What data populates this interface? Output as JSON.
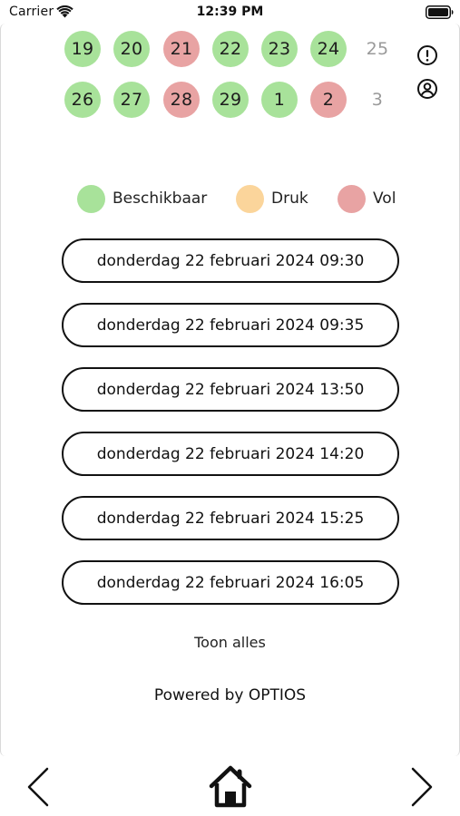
{
  "status_bar": {
    "carrier": "Carrier",
    "time": "12:39 PM"
  },
  "calendar": {
    "weeks": [
      [
        {
          "day": "19",
          "status": "available"
        },
        {
          "day": "20",
          "status": "available"
        },
        {
          "day": "21",
          "status": "full"
        },
        {
          "day": "22",
          "status": "available"
        },
        {
          "day": "23",
          "status": "available"
        },
        {
          "day": "24",
          "status": "available"
        },
        {
          "day": "25",
          "status": "unavailable"
        }
      ],
      [
        {
          "day": "26",
          "status": "available"
        },
        {
          "day": "27",
          "status": "available"
        },
        {
          "day": "28",
          "status": "full"
        },
        {
          "day": "29",
          "status": "available"
        },
        {
          "day": "1",
          "status": "available"
        },
        {
          "day": "2",
          "status": "full"
        },
        {
          "day": "3",
          "status": "unavailable"
        }
      ]
    ],
    "icons": [
      "info-icon",
      "account-icon"
    ]
  },
  "legend": [
    {
      "label": "Beschikbaar",
      "color": "#a8e29a"
    },
    {
      "label": "Druk",
      "color": "#fbd59b"
    },
    {
      "label": "Vol",
      "color": "#e8a3a3"
    }
  ],
  "slots": [
    "donderdag 22 februari 2024 09:30",
    "donderdag 22 februari 2024 09:35",
    "donderdag 22 februari 2024 13:50",
    "donderdag 22 februari 2024 14:20",
    "donderdag 22 februari 2024 15:25",
    "donderdag 22 februari 2024 16:05"
  ],
  "show_all_label": "Toon alles",
  "powered_by": "Powered by OPTIOS",
  "bottom_nav": {
    "icons": [
      "back-icon",
      "home-icon",
      "forward-icon"
    ]
  },
  "colors": {
    "available": "#a8e29a",
    "busy": "#fbd59b",
    "full": "#e8a3a3",
    "unavailable_text": "#9a9a9a"
  }
}
